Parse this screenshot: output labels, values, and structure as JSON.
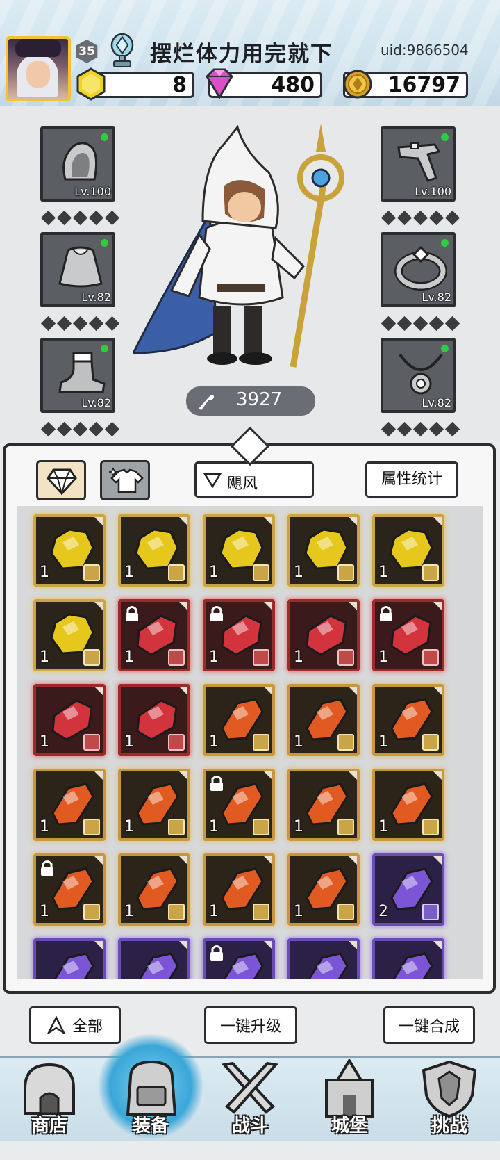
{
  "header": {
    "player_level": "35",
    "player_name": "摆烂体力用完就下",
    "uid": "uid:9866504",
    "currencies": {
      "energy": "8",
      "gems": "480",
      "gold": "16797"
    }
  },
  "equipment": {
    "left_slots": [
      {
        "name": "hood",
        "level": "Lv.100"
      },
      {
        "name": "cape",
        "level": "Lv.82"
      },
      {
        "name": "boots",
        "level": "Lv.82"
      }
    ],
    "right_slots": [
      {
        "name": "pistol",
        "level": "Lv.100"
      },
      {
        "name": "ring",
        "level": "Lv.82"
      },
      {
        "name": "necklace",
        "level": "Lv.82"
      }
    ],
    "power": "3927"
  },
  "inventory": {
    "filter_label": "飓风",
    "stats_label": "属性统计",
    "tabs": [
      "gem-tab",
      "costume-tab"
    ],
    "rows": [
      [
        {
          "type": "gold",
          "qty": "1"
        },
        {
          "type": "gold",
          "qty": "1"
        },
        {
          "type": "gold",
          "qty": "1"
        },
        {
          "type": "gold",
          "qty": "1"
        },
        {
          "type": "gold",
          "qty": "1"
        }
      ],
      [
        {
          "type": "gold",
          "qty": "1"
        },
        {
          "type": "red",
          "qty": "1",
          "lock": true
        },
        {
          "type": "red",
          "qty": "1",
          "lock": true
        },
        {
          "type": "red",
          "qty": "1"
        },
        {
          "type": "red",
          "qty": "1",
          "lock": true
        }
      ],
      [
        {
          "type": "red",
          "qty": "1"
        },
        {
          "type": "red",
          "qty": "1"
        },
        {
          "type": "orange",
          "qty": "1"
        },
        {
          "type": "orange",
          "qty": "1"
        },
        {
          "type": "orange",
          "qty": "1"
        }
      ],
      [
        {
          "type": "orange",
          "qty": "1"
        },
        {
          "type": "orange",
          "qty": "1"
        },
        {
          "type": "orange",
          "qty": "1",
          "lock": true
        },
        {
          "type": "orange",
          "qty": "1"
        },
        {
          "type": "orange",
          "qty": "1"
        }
      ],
      [
        {
          "type": "orange",
          "qty": "1",
          "lock": true
        },
        {
          "type": "orange",
          "qty": "1"
        },
        {
          "type": "orange",
          "qty": "1"
        },
        {
          "type": "orange",
          "qty": "1"
        },
        {
          "type": "purple",
          "qty": "2"
        }
      ],
      [
        {
          "type": "purple",
          "qty": ""
        },
        {
          "type": "purple",
          "qty": ""
        },
        {
          "type": "purple",
          "qty": "",
          "lock": true
        },
        {
          "type": "purple",
          "qty": ""
        },
        {
          "type": "purple",
          "qty": ""
        }
      ]
    ]
  },
  "actions": {
    "all_label": "全部",
    "upgrade_all_label": "一键升级",
    "merge_all_label": "一键合成"
  },
  "nav": {
    "items": [
      "商店",
      "装备",
      "战斗",
      "城堡",
      "挑战"
    ],
    "active": "装备"
  },
  "colors": {
    "gold_gem": "#e6c81c",
    "red_gem": "#d2333d",
    "orange_gem": "#e05a22",
    "purple_gem": "#7c55d6",
    "active_nav": "#3aa6d8"
  }
}
